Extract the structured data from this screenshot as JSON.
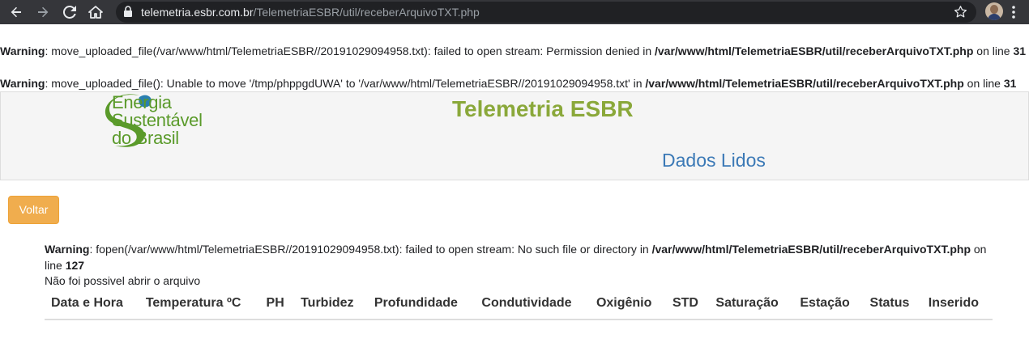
{
  "browser": {
    "url_host": "telemetria.esbr.com.br",
    "url_path": "/TelemetriaESBR/util/receberArquivoTXT.php",
    "icons": [
      "back-icon",
      "forward-icon",
      "reload-icon",
      "home-icon",
      "lock-icon",
      "star-icon",
      "profile-avatar",
      "menu-icon"
    ]
  },
  "warnings": [
    {
      "label": "Warning",
      "message": ": move_uploaded_file(/var/www/html/TelemetriaESBR//20191029094958.txt): failed to open stream: Permission denied in ",
      "file": "/var/www/html/TelemetriaESBR/util/receberArquivoTXT.php",
      "on_line": " on line ",
      "line": "31"
    },
    {
      "label": "Warning",
      "message": ": move_uploaded_file(): Unable to move '/tmp/phppgdUWA' to '/var/www/html/TelemetriaESBR//20191029094958.txt' in ",
      "file": "/var/www/html/TelemetriaESBR/util/receberArquivoTXT.php",
      "on_line": " on line ",
      "line": "31"
    },
    {
      "label": "Warning",
      "message": ": fopen(/var/www/html/TelemetriaESBR//20191029094958.txt): failed to open stream: No such file or directory in ",
      "file": "/var/www/html/TelemetriaESBR/util/receberArquivoTXT.php",
      "on_line": " on line ",
      "line": "127"
    }
  ],
  "header": {
    "logo_line1": "Energia",
    "logo_line2": "Sustentável",
    "logo_line3": "do Brasil",
    "title": "Telemetria ESBR",
    "subtitle": "Dados Lidos"
  },
  "back_button": "Voltar",
  "error_message": "Não foi possivel abrir o arquivo",
  "table": {
    "columns": [
      "Data e Hora",
      "Temperatura ºC",
      "PH",
      "Turbidez",
      "Profundidade",
      "Condutividade",
      "Oxigênio",
      "STD",
      "Saturação",
      "Estação",
      "Status",
      "Inserido"
    ]
  },
  "colors": {
    "title_green": "#8aa83a",
    "subtitle_blue": "#3b79b6",
    "button_orange": "#f0ad4e",
    "logo_green": "#5a9a2a",
    "logo_blue": "#2a7fb0"
  }
}
